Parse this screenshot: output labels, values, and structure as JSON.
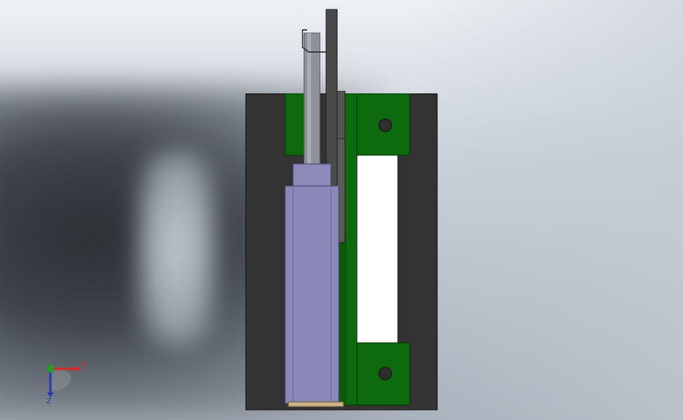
{
  "viewport": {
    "background_top": "#eef1f5",
    "background_bottom": "#a9b1bc"
  },
  "model": {
    "frame_color": "#333333",
    "plate_color": "#0e6a0e",
    "cylinder_color": "#8a88b8",
    "rod_color": "#8e9199",
    "bolt_color": "#2e2e2e"
  },
  "triad": {
    "x_label": "X",
    "y_label": "Y",
    "z_label": "Z",
    "x_color": "#d42a2a",
    "y_color": "#2a8a2a",
    "z_color": "#2a3ab0"
  }
}
